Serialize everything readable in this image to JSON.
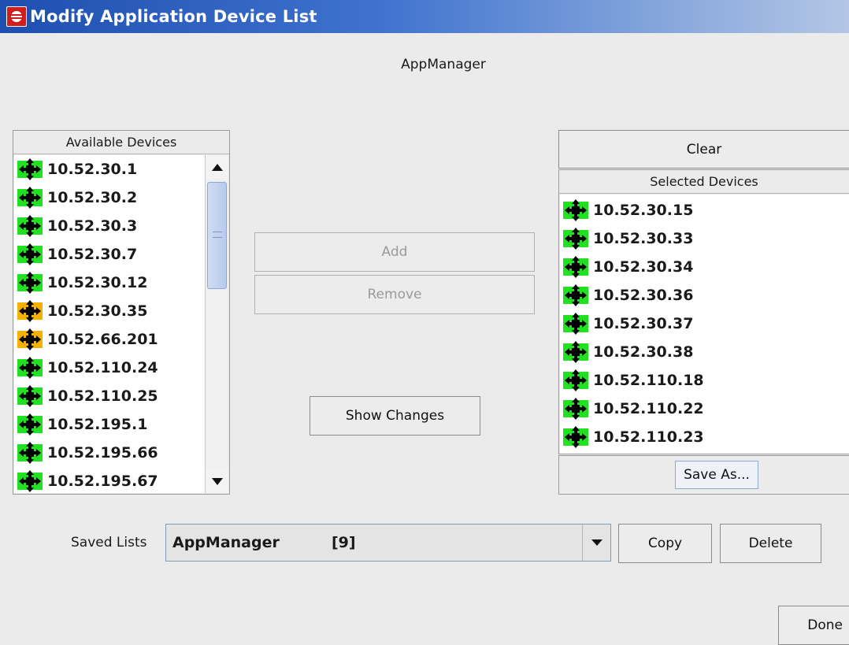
{
  "window": {
    "title": "Modify Application Device List"
  },
  "app_name": "AppManager",
  "available": {
    "header": "Available Devices",
    "devices": [
      {
        "ip": "10.52.30.1",
        "status": "green"
      },
      {
        "ip": "10.52.30.2",
        "status": "green"
      },
      {
        "ip": "10.52.30.3",
        "status": "green"
      },
      {
        "ip": "10.52.30.7",
        "status": "green"
      },
      {
        "ip": "10.52.30.12",
        "status": "green"
      },
      {
        "ip": "10.52.30.35",
        "status": "orange"
      },
      {
        "ip": "10.52.66.201",
        "status": "orange"
      },
      {
        "ip": "10.52.110.24",
        "status": "green"
      },
      {
        "ip": "10.52.110.25",
        "status": "green"
      },
      {
        "ip": "10.52.195.1",
        "status": "green"
      },
      {
        "ip": "10.52.195.66",
        "status": "green"
      },
      {
        "ip": "10.52.195.67",
        "status": "green"
      }
    ],
    "scroll_up_icon": "arrow-up-icon",
    "scroll_down_icon": "arrow-down-icon"
  },
  "actions": {
    "add": "Add",
    "remove": "Remove",
    "show_changes": "Show Changes"
  },
  "selected": {
    "clear": "Clear",
    "header": "Selected Devices",
    "devices": [
      {
        "ip": "10.52.30.15",
        "status": "green"
      },
      {
        "ip": "10.52.30.33",
        "status": "green"
      },
      {
        "ip": "10.52.30.34",
        "status": "green"
      },
      {
        "ip": "10.52.30.36",
        "status": "green"
      },
      {
        "ip": "10.52.30.37",
        "status": "green"
      },
      {
        "ip": "10.52.30.38",
        "status": "green"
      },
      {
        "ip": "10.52.110.18",
        "status": "green"
      },
      {
        "ip": "10.52.110.22",
        "status": "green"
      },
      {
        "ip": "10.52.110.23",
        "status": "green"
      }
    ],
    "save_as": "Save As..."
  },
  "saved_lists": {
    "label": "Saved Lists",
    "value": "AppManager",
    "count": "[9]",
    "copy": "Copy",
    "delete": "Delete"
  },
  "done": "Done",
  "colors": {
    "green": "#22e022",
    "orange": "#f5b000",
    "title_bar": "#1e4fb0"
  }
}
